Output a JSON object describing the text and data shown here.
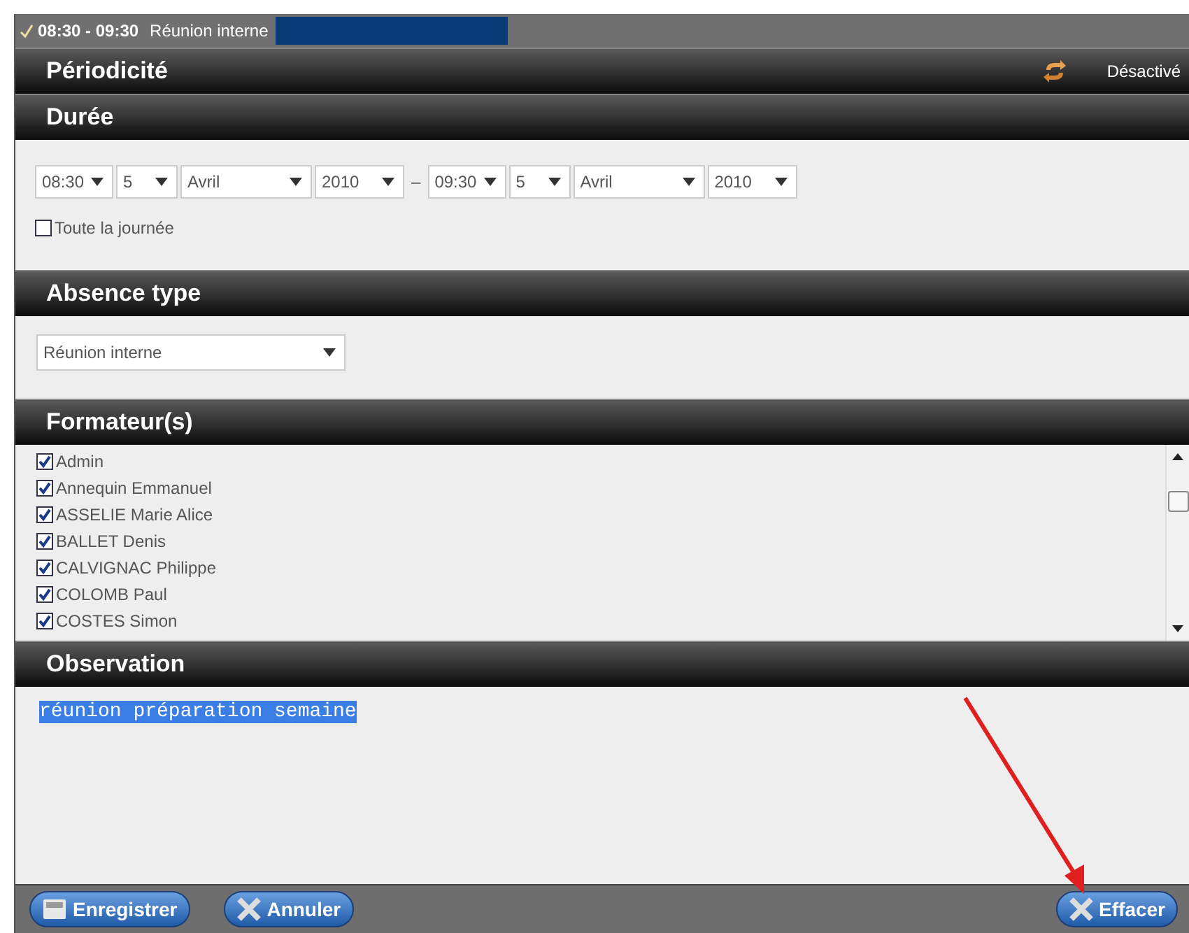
{
  "title_bar": {
    "time": "08:30 - 09:30",
    "subject": "Réunion interne"
  },
  "periodicity": {
    "heading": "Périodicité",
    "status": "Désactivé"
  },
  "duration": {
    "heading": "Durée",
    "start": {
      "time": "08:30",
      "day": "5",
      "month": "Avril",
      "year": "2010"
    },
    "separator": "–",
    "end": {
      "time": "09:30",
      "day": "5",
      "month": "Avril",
      "year": "2010"
    },
    "all_day": {
      "label": "Toute la journée",
      "checked": false
    }
  },
  "absence_type": {
    "heading": "Absence type",
    "value": "Réunion interne"
  },
  "trainers": {
    "heading": "Formateur(s)",
    "items": [
      {
        "name": "Admin",
        "checked": true
      },
      {
        "name": "Annequin Emmanuel",
        "checked": true
      },
      {
        "name": "ASSELIE Marie Alice",
        "checked": true
      },
      {
        "name": "BALLET Denis",
        "checked": true
      },
      {
        "name": "CALVIGNAC Philippe",
        "checked": true
      },
      {
        "name": "COLOMB Paul",
        "checked": true
      },
      {
        "name": "COSTES Simon",
        "checked": true
      }
    ]
  },
  "observation": {
    "heading": "Observation",
    "value": "réunion préparation semaine"
  },
  "buttons": [
    {
      "label": "Enregistrer",
      "kind": "save"
    },
    {
      "label": "Annuler",
      "kind": "cancel"
    },
    {
      "label": "Effacer",
      "kind": "delete"
    }
  ]
}
